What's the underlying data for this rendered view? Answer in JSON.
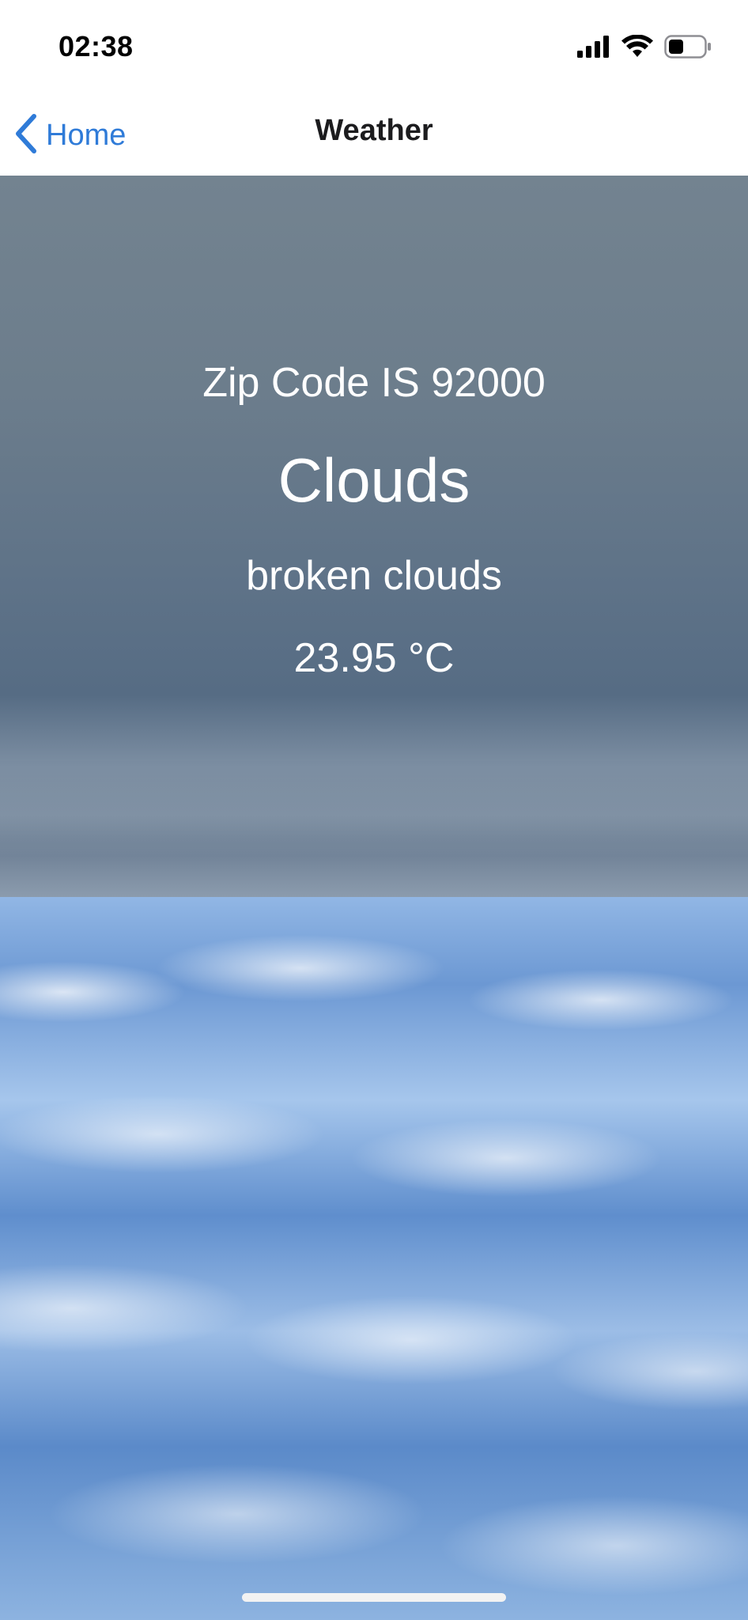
{
  "status_bar": {
    "time": "02:38",
    "icons": [
      "cellular-signal-icon",
      "wifi-icon",
      "battery-icon"
    ]
  },
  "nav": {
    "back_label": "Home",
    "back_icon": "chevron-left-icon",
    "title": "Weather"
  },
  "weather": {
    "zip_text": "Zip Code IS 92000",
    "condition": "Clouds",
    "description": "broken clouds",
    "temperature": "23.95 °C"
  },
  "colors": {
    "accent": "#2f7bd8",
    "overlay": "#6c7d8c",
    "text_on_overlay": "#ffffff"
  }
}
